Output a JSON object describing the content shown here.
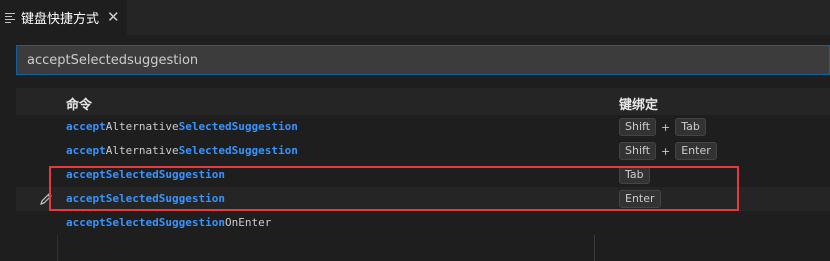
{
  "tab": {
    "title": "键盘快捷方式",
    "icon": "list-icon",
    "close_glyph": "✕"
  },
  "search": {
    "value": "acceptSelectedsuggestion"
  },
  "table": {
    "headers": {
      "command": "命令",
      "keybinding": "键绑定"
    },
    "rows": [
      {
        "segments": [
          {
            "text": "accept",
            "match": true
          },
          {
            "text": "Alternative",
            "match": false
          },
          {
            "text": "SelectedSuggestion",
            "match": true
          }
        ],
        "keys": [
          "Shift",
          "Tab"
        ]
      },
      {
        "segments": [
          {
            "text": "accept",
            "match": true
          },
          {
            "text": "Alternative",
            "match": false
          },
          {
            "text": "SelectedSuggestion",
            "match": true
          }
        ],
        "keys": [
          "Shift",
          "Enter"
        ]
      },
      {
        "segments": [
          {
            "text": "acceptSelectedSuggestion",
            "match": true
          }
        ],
        "keys": [
          "Tab"
        ]
      },
      {
        "segments": [
          {
            "text": "acceptSelectedSuggestion",
            "match": true
          }
        ],
        "keys": [
          "Enter"
        ],
        "editing": true
      },
      {
        "segments": [
          {
            "text": "acceptSelectedSuggestion",
            "match": true
          },
          {
            "text": "OnEnter",
            "match": false
          }
        ],
        "keys": []
      }
    ],
    "key_separator": "+"
  },
  "colors": {
    "match": "#3794ff",
    "highlight_box": "#e5393b",
    "input_border": "#0e639c"
  }
}
